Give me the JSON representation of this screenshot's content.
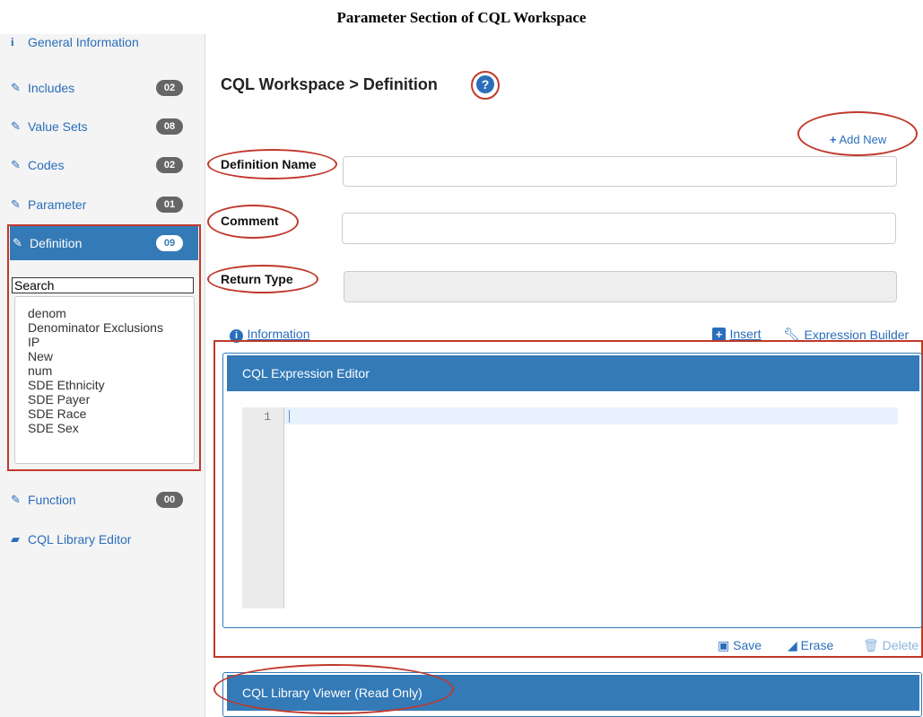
{
  "doc_title": "Parameter Section of CQL Workspace",
  "sidebar": {
    "general": "General Information",
    "items": [
      {
        "label": "Includes",
        "count": "02"
      },
      {
        "label": "Value Sets",
        "count": "08"
      },
      {
        "label": "Codes",
        "count": "02"
      },
      {
        "label": "Parameter",
        "count": "01"
      },
      {
        "label": "Definition",
        "count": "09"
      },
      {
        "label": "Function",
        "count": "00"
      }
    ],
    "library_editor": "CQL Library Editor",
    "search_value": "Search",
    "definitions": [
      "denom",
      "Denominator Exclusions",
      "IP",
      "New",
      "num",
      "SDE Ethnicity",
      "SDE Payer",
      "SDE Race",
      "SDE Sex"
    ]
  },
  "main": {
    "breadcrumb": "CQL Workspace > Definition",
    "help_icon": "?",
    "add_new": "Add New",
    "definition_name_label": "Definition Name",
    "comment_label": "Comment",
    "return_type_label": "Return Type",
    "information_link": "Information",
    "insert_link": "Insert",
    "expression_builder_link": "Expression Builder",
    "editor_title": "CQL Expression Editor",
    "line_number": "1",
    "save": "Save",
    "erase": "Erase",
    "delete": "Delete",
    "viewer_title": "CQL Library Viewer (Read Only)"
  },
  "colors": {
    "accent": "#337ab7",
    "highlight": "#c0392b",
    "link": "#2a6ebb"
  }
}
